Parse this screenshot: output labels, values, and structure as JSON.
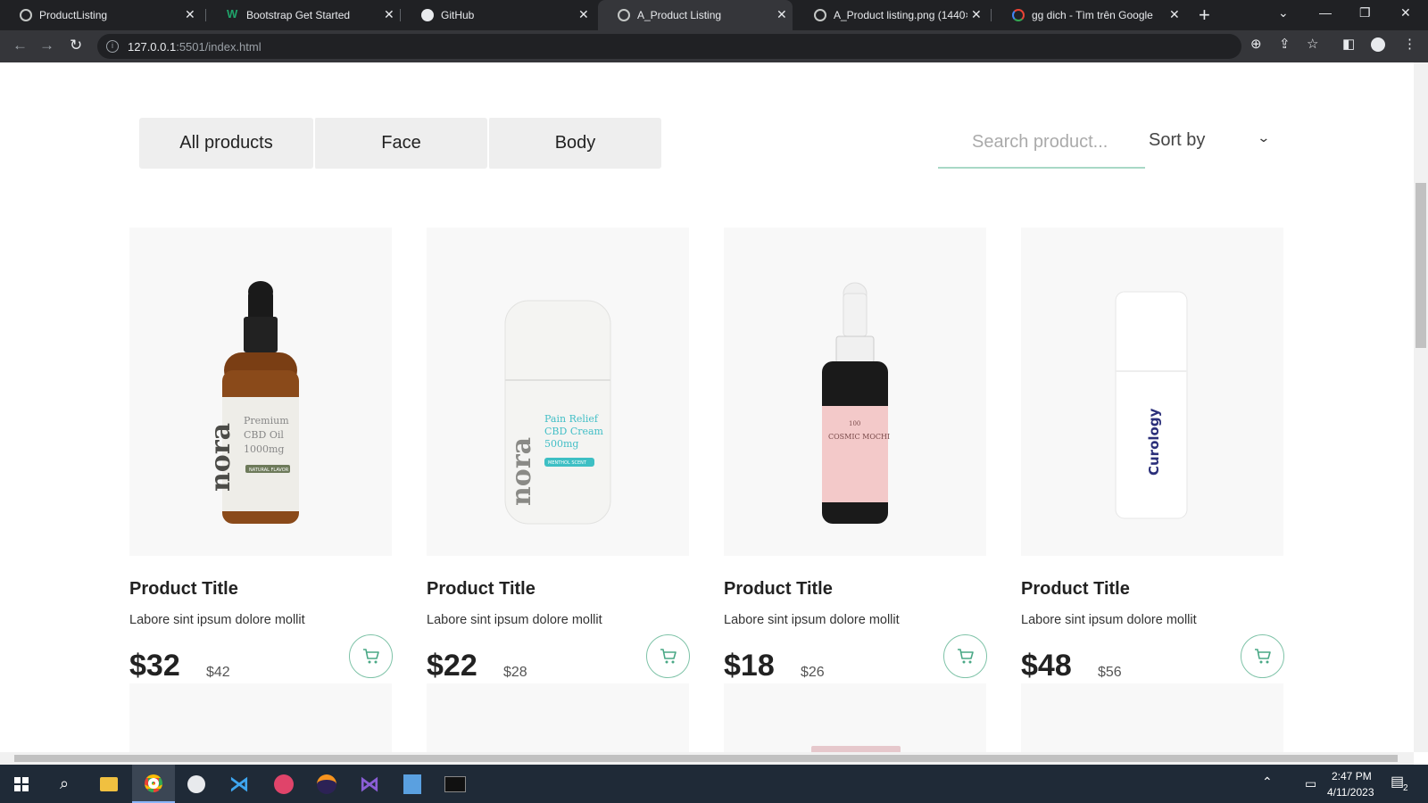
{
  "browser": {
    "tabs": [
      {
        "label": "ProductListing",
        "icon": "globe-icon"
      },
      {
        "label": "Bootstrap Get Started",
        "icon": "w3schools-icon"
      },
      {
        "label": "GitHub",
        "icon": "github-icon"
      },
      {
        "label": "A_Product Listing",
        "icon": "globe-icon",
        "active": true
      },
      {
        "label": "A_Product listing.png (1440×",
        "icon": "globe-icon"
      },
      {
        "label": "gg dich - Tìm trên Google",
        "icon": "google-icon"
      }
    ],
    "url_host": "127.0.0.1",
    "url_rest": ":5501/index.html"
  },
  "filters": {
    "all": "All products",
    "face": "Face",
    "body": "Body"
  },
  "search": {
    "placeholder": "Search product..."
  },
  "sort": {
    "label": "Sort by"
  },
  "products": [
    {
      "title": "Product Title",
      "desc": "Labore sint ipsum dolore mollit",
      "price": "$32",
      "old_price": "$42",
      "brand_text": "nora",
      "label_text": "Premium CBD Oil 1000mg",
      "tag": "NATURAL FLAVOR"
    },
    {
      "title": "Product Title",
      "desc": "Labore sint ipsum dolore mollit",
      "price": "$22",
      "old_price": "$28",
      "brand_text": "nora",
      "label_text": "Pain Relief CBD Cream 500mg",
      "tag": "MENTHOL SCENT"
    },
    {
      "title": "Product Title",
      "desc": "Labore sint ipsum dolore mollit",
      "price": "$18",
      "old_price": "$26",
      "brand_text": "COSMIC MOCHI",
      "label_text": "100"
    },
    {
      "title": "Product Title",
      "desc": "Labore sint ipsum dolore mollit",
      "price": "$48",
      "old_price": "$56",
      "brand_text": "Curology"
    }
  ],
  "taskbar": {
    "time": "2:47 PM",
    "date": "4/11/2023",
    "notifications": "2"
  },
  "colors": {
    "accent": "#7fc3a8",
    "chrome_dark": "#202124",
    "filter_bg": "#eeeeee",
    "card_bg": "#f8f8f8"
  }
}
